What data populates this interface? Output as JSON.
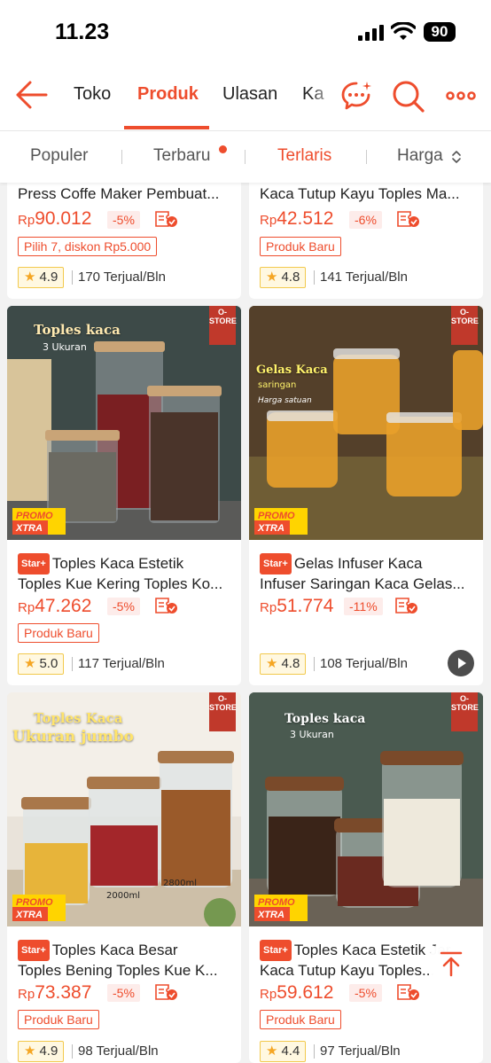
{
  "status": {
    "time": "11.23",
    "battery": "90"
  },
  "nav": {
    "tabs": [
      "Toko",
      "Produk",
      "Ulasan",
      "Ka"
    ],
    "active": "Produk"
  },
  "sort": {
    "items": [
      "Populer",
      "Terbaru",
      "Terlaris",
      "Harga"
    ],
    "active": "Terlaris"
  },
  "products": [
    {
      "title1": "Press Coffe Maker Pembuat...",
      "price_currency": "Rp",
      "price_value": "90.012",
      "discount": "-5%",
      "tag": "Pilih 7, diskon Rp5.000",
      "rating": "4.9",
      "sold": "170 Terjual/Bln"
    },
    {
      "title1": "Kaca Tutup Kayu Toples Ma...",
      "price_currency": "Rp",
      "price_value": "42.512",
      "discount": "-6%",
      "tag": "Produk Baru",
      "rating": "4.8",
      "sold": "141 Terjual/Bln"
    },
    {
      "badge": "Star+",
      "title1": "Toples Kaca Estetik",
      "title2": "Toples Kue Kering Toples Ko...",
      "price_currency": "Rp",
      "price_value": "47.262",
      "discount": "-5%",
      "tag": "Produk Baru",
      "rating": "5.0",
      "sold": "117 Terjual/Bln",
      "img_title": "Toples kaca",
      "img_sub": "3 Ukuran",
      "promo": "PROMO XTRA",
      "brand": "O-STORE"
    },
    {
      "badge": "Star+",
      "title1": "Gelas Infuser Kaca",
      "title2": "Infuser Saringan Kaca Gelas...",
      "price_currency": "Rp",
      "price_value": "51.774",
      "discount": "-11%",
      "rating": "4.8",
      "sold": "108 Terjual/Bln",
      "img_title": "Gelas Kaca",
      "img_sub": "saringan",
      "img_sub2": "Harga satuan",
      "promo": "PROMO XTRA",
      "brand": "O-STORE"
    },
    {
      "badge": "Star+",
      "title1": "Toples Kaca Besar",
      "title2": "Toples Bening Toples Kue K...",
      "price_currency": "Rp",
      "price_value": "73.387",
      "discount": "-5%",
      "tag": "Produk Baru",
      "rating": "4.9",
      "sold": "98 Terjual/Bln",
      "img_title": "Toples Kaca",
      "img_sub": "Ukuran jumbo",
      "img_label_a": "2000ml",
      "img_label_b": "2800ml",
      "promo": "PROMO XTRA",
      "brand": "O-STORE"
    },
    {
      "badge": "Star+",
      "title1": "Toples Kaca Estetik Jar",
      "title2": "Kaca Tutup Kayu Toples...",
      "price_currency": "Rp",
      "price_value": "59.612",
      "discount": "-5%",
      "tag": "Produk Baru",
      "rating": "4.4",
      "sold": "97 Terjual/Bln",
      "img_title": "Toples kaca",
      "img_sub": "3 Ukuran",
      "promo": "PROMO XTRA",
      "brand": "O-STORE"
    }
  ],
  "colors": {
    "accent": "#ee4d2d",
    "rating_bg": "#fff8e1"
  }
}
